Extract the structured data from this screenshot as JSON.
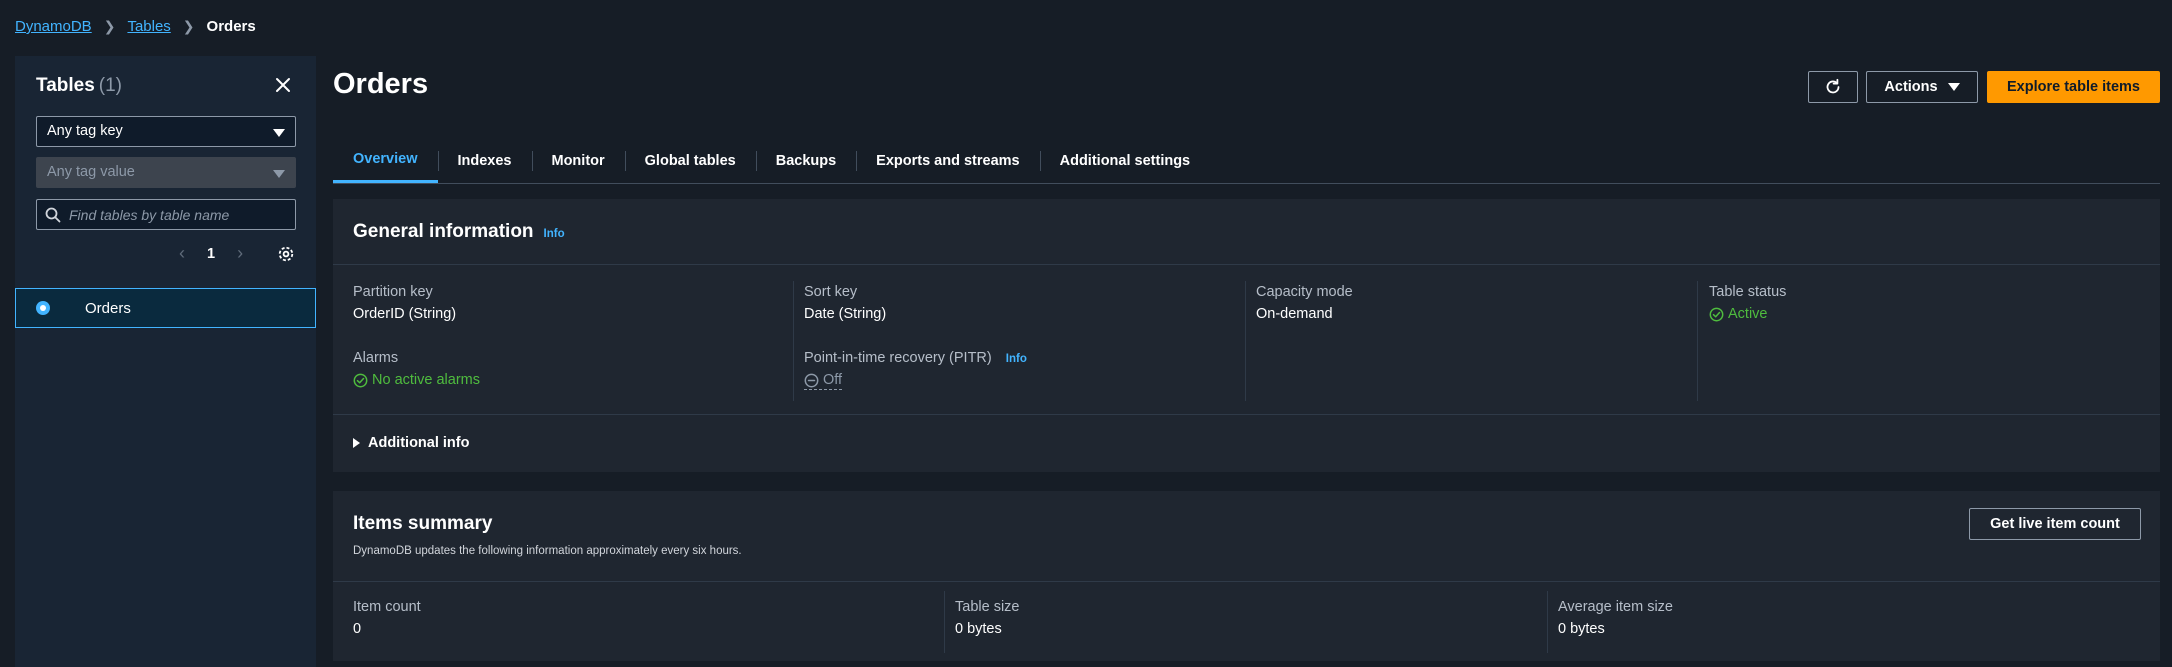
{
  "breadcrumb": {
    "items": [
      "DynamoDB",
      "Tables"
    ],
    "current": "Orders"
  },
  "sidebar": {
    "title": "Tables",
    "count": "(1)",
    "tag_key_select": "Any tag key",
    "tag_value_select": "Any tag value",
    "search_placeholder": "Find tables by table name",
    "page": "1",
    "tables": [
      {
        "name": "Orders",
        "selected": true
      }
    ]
  },
  "main": {
    "title": "Orders",
    "actions_label": "Actions",
    "explore_label": "Explore table items",
    "tabs": [
      {
        "label": "Overview",
        "active": true
      },
      {
        "label": "Indexes",
        "active": false
      },
      {
        "label": "Monitor",
        "active": false
      },
      {
        "label": "Global tables",
        "active": false
      },
      {
        "label": "Backups",
        "active": false
      },
      {
        "label": "Exports and streams",
        "active": false
      },
      {
        "label": "Additional settings",
        "active": false
      }
    ]
  },
  "general_info": {
    "title": "General information",
    "info_label": "Info",
    "partition_key_label": "Partition key",
    "partition_key_value": "OrderID (String)",
    "sort_key_label": "Sort key",
    "sort_key_value": "Date (String)",
    "capacity_mode_label": "Capacity mode",
    "capacity_mode_value": "On-demand",
    "table_status_label": "Table status",
    "table_status_value": "Active",
    "alarms_label": "Alarms",
    "alarms_value": "No active alarms",
    "pitr_label": "Point-in-time recovery (PITR)",
    "pitr_info_label": "Info",
    "pitr_value": "Off",
    "additional_info_label": "Additional info"
  },
  "items_summary": {
    "title": "Items summary",
    "subtitle": "DynamoDB updates the following information approximately every six hours.",
    "get_count_label": "Get live item count",
    "item_count_label": "Item count",
    "item_count_value": "0",
    "table_size_label": "Table size",
    "table_size_value": "0 bytes",
    "avg_item_size_label": "Average item size",
    "avg_item_size_value": "0 bytes"
  },
  "colors": {
    "accent": "#42b4ff",
    "primary_button": "#ff9900",
    "success": "#4fbc3e",
    "background": "#161d26",
    "panel": "#1f2630"
  }
}
